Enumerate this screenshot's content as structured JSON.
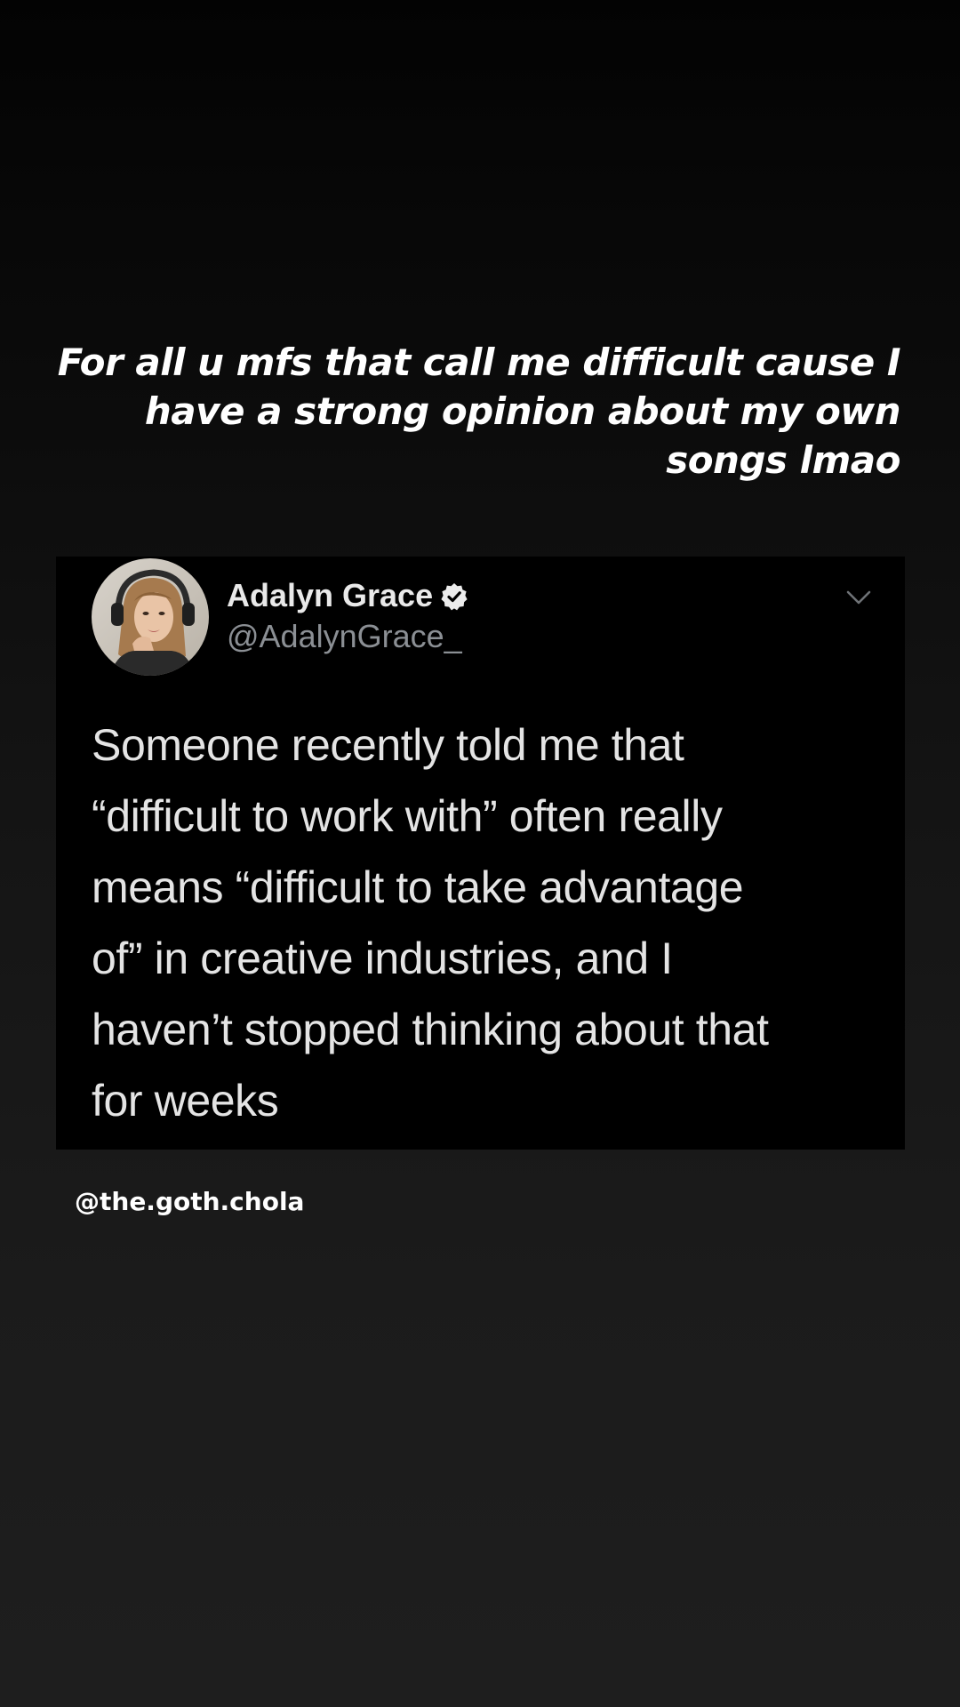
{
  "story": {
    "caption_lines": [
      "For all u mfs that call me difficult cause I",
      "have a strong opinion about my own",
      "songs lmao"
    ],
    "attribution": "@the.goth.chola"
  },
  "tweet": {
    "author_name": "Adalyn Grace",
    "author_handle": "@AdalynGrace_",
    "verified_icon": "verified-badge-icon",
    "menu_icon": "chevron-down-icon",
    "text_lines": [
      "Someone recently told me that",
      "“difficult to work with” often really",
      "means “difficult to take advantage",
      "of” in creative industries, and I",
      "haven’t stopped thinking about that",
      "for weeks"
    ]
  },
  "colors": {
    "card_background": "#000000",
    "handle_gray": "#8b8f94",
    "text_light": "#e4e4e4"
  }
}
